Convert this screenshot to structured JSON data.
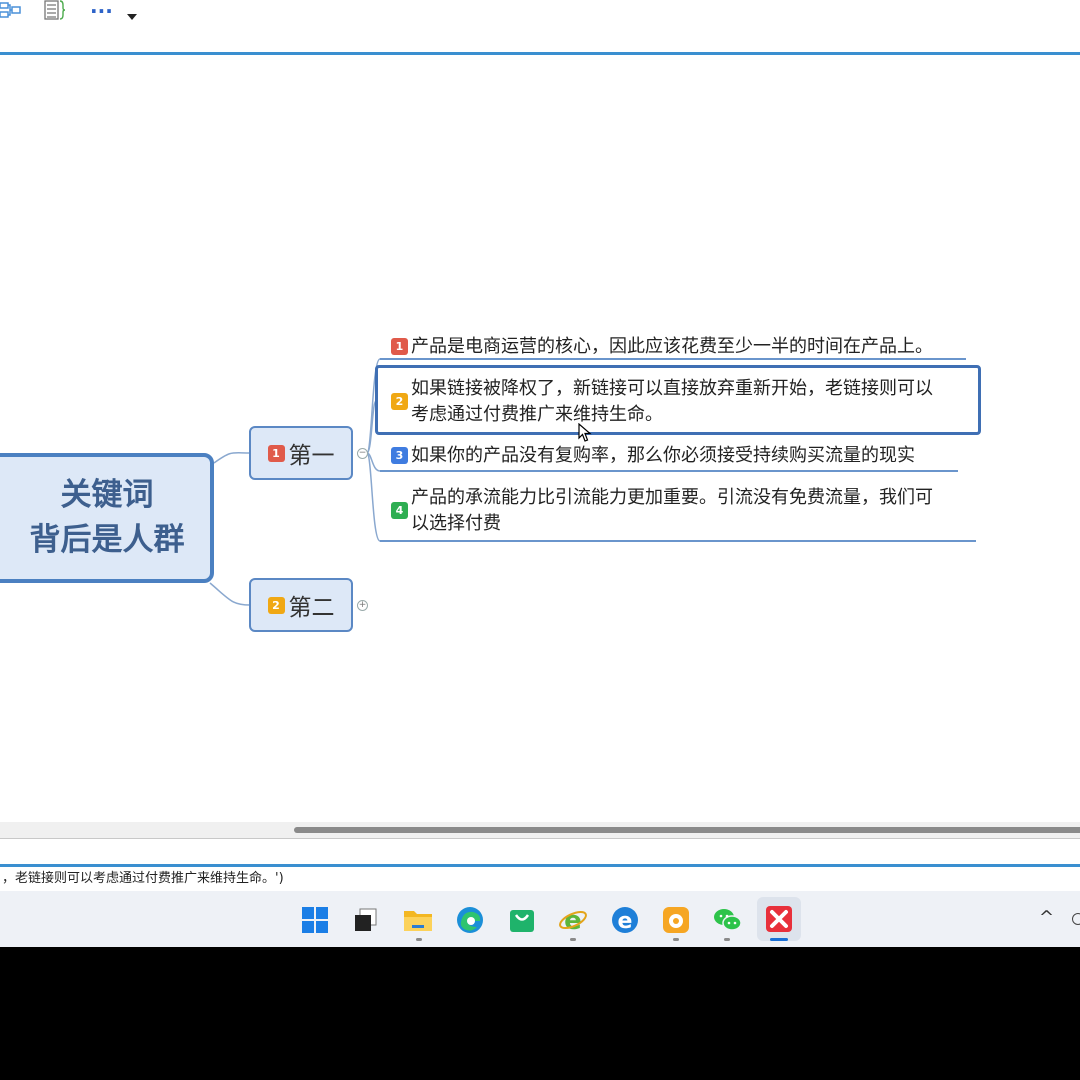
{
  "toolbar": {
    "icons": [
      "mindmap-structure-icon",
      "outline-icon",
      "more-icon",
      "dropdown-icon"
    ],
    "more_label": "···"
  },
  "mindmap": {
    "central_line1": "关键词",
    "central_line2": "背后是人群",
    "branches": [
      {
        "badge": "1",
        "badge_color": "#e05a4a",
        "label": "第一"
      },
      {
        "badge": "2",
        "badge_color": "#f0a814",
        "label": "第二"
      }
    ],
    "topics": [
      {
        "badge": "1",
        "badge_color": "#e05a4a",
        "line1": "产品是电商运营的核心，因此应该花费至少一半的时间在产品上。",
        "line2": ""
      },
      {
        "badge": "2",
        "badge_color": "#f0a814",
        "line1": "如果链接被降权了，新链接可以直接放弃重新开始，老链接则可以",
        "line2": "考虑通过付费推广来维持生命。"
      },
      {
        "badge": "3",
        "badge_color": "#3f7ce0",
        "line1": "如果你的产品没有复购率，那么你必须接受持续购买流量的现实",
        "line2": ""
      },
      {
        "badge": "4",
        "badge_color": "#2eae52",
        "line1": "产品的承流能力比引流能力更加重要。引流没有免费流量，我们可",
        "line2": "以选择付费"
      }
    ],
    "accent": "#4b80c1"
  },
  "statusbar": {
    "text": "，老链接则可以考虑通过付费推广来维持生命。')"
  },
  "taskbar": {
    "apps": [
      "windows-start-icon",
      "task-view-icon",
      "file-explorer-icon",
      "edge-icon",
      "store-icon",
      "ie-browser-icon",
      "edge-legacy-icon",
      "uc-browser-icon",
      "wechat-icon",
      "xmind-icon"
    ],
    "tray_chevron": "^"
  }
}
